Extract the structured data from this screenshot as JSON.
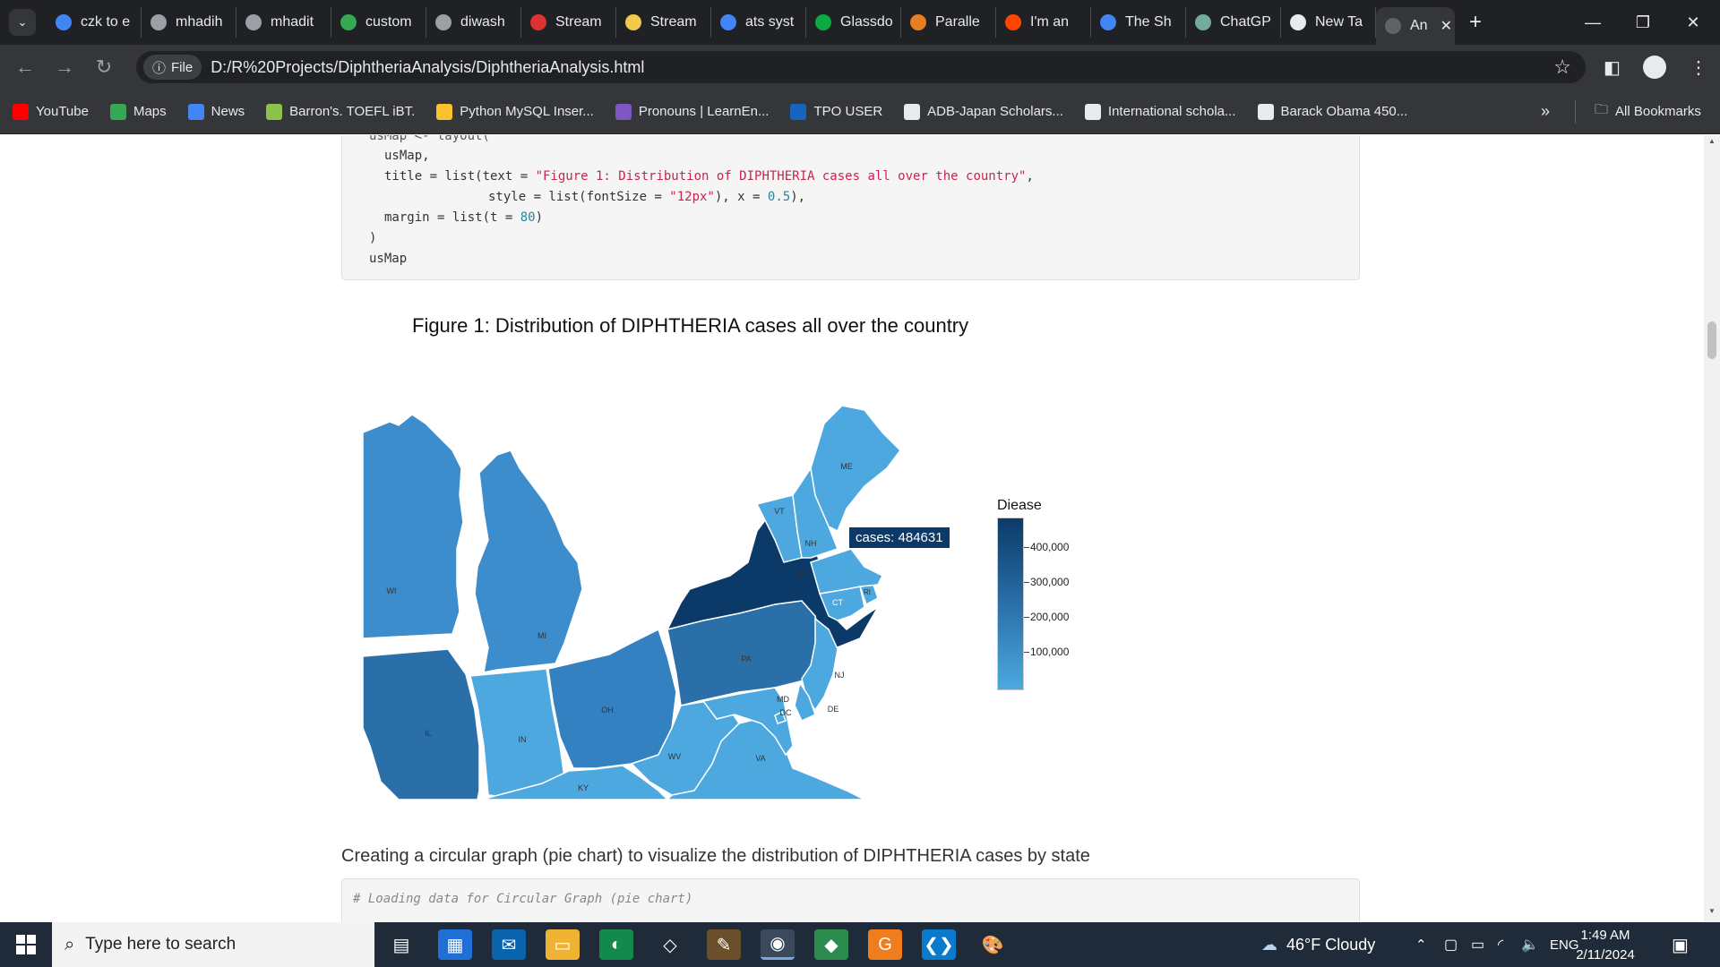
{
  "browser": {
    "tabs": [
      {
        "label": "czk to e",
        "color": "#4285f4"
      },
      {
        "label": "mhadih",
        "color": "#9aa0a6"
      },
      {
        "label": "mhadit",
        "color": "#9aa0a6"
      },
      {
        "label": "custom",
        "color": "#34a853"
      },
      {
        "label": "diwash",
        "color": "#9aa0a6"
      },
      {
        "label": "Stream",
        "color": "#e03131"
      },
      {
        "label": "Stream",
        "color": "#f2c94c"
      },
      {
        "label": "ats syst",
        "color": "#4285f4"
      },
      {
        "label": "Glassdo",
        "color": "#0caa41"
      },
      {
        "label": "Paralle",
        "color": "#e67e22"
      },
      {
        "label": "I'm an",
        "color": "#ff4500"
      },
      {
        "label": "The Sh",
        "color": "#4285f4"
      },
      {
        "label": "ChatGP",
        "color": "#74aa9c"
      },
      {
        "label": "New Ta",
        "color": "#e8eaed"
      }
    ],
    "active_tab": "An",
    "new_tab_icon": "+",
    "url": "D:/R%20Projects/DiphtheriaAnalysis/DiphtheriaAnalysis.html",
    "file_chip": "File",
    "bookmarks": [
      {
        "label": "YouTube",
        "color": "#ff0000"
      },
      {
        "label": "Maps",
        "color": "#34a853"
      },
      {
        "label": "News",
        "color": "#4285f4"
      },
      {
        "label": "Barron's. TOEFL iBT.",
        "color": "#8bc34a"
      },
      {
        "label": "Python MySQL Inser...",
        "color": "#fbc02d"
      },
      {
        "label": "Pronouns | LearnEn...",
        "color": "#7e57c2"
      },
      {
        "label": "TPO USER",
        "color": "#1565c0"
      },
      {
        "label": "ADB-Japan Scholars...",
        "color": "#e8eaed"
      },
      {
        "label": "International schola...",
        "color": "#e8eaed"
      },
      {
        "label": "Barack Obama 450...",
        "color": "#e8eaed"
      }
    ],
    "all_bookmarks": "All Bookmarks",
    "more_bookmarks": "»"
  },
  "page": {
    "code_top": {
      "partial": "usMap <- layout(",
      "l1": "usMap,",
      "l2_pre": "title = list(text = ",
      "l2_str": "\"Figure 1: Distribution of DIPHTHERIA cases all over the country\"",
      "l2_post": ",",
      "l3_pre": "style = list(fontSize = ",
      "l3_str": "\"12px\"",
      "l3_mid": "), x = ",
      "l3_num": "0.5",
      "l3_post": "),",
      "l4_pre": "margin = list(t = ",
      "l4_num": "80",
      "l4_post": ")",
      "l5": ")",
      "l6": "usMap"
    },
    "figure_title": "Figure 1: Distribution of DIPHTHERIA cases all over the country",
    "map": {
      "states": [
        {
          "abbr": "ME",
          "color": "#4da8e0"
        },
        {
          "abbr": "VT",
          "color": "#4da8e0"
        },
        {
          "abbr": "NH",
          "color": "#4da8e0"
        },
        {
          "abbr": "NY",
          "color": "#0c3a68"
        },
        {
          "abbr": "CT",
          "color": "#4da8e0"
        },
        {
          "abbr": "RI",
          "color": "#4da8e0"
        },
        {
          "abbr": "WI",
          "color": "#3d8ccc"
        },
        {
          "abbr": "MI",
          "color": "#3d8ccc"
        },
        {
          "abbr": "PA",
          "color": "#2a6fa8"
        },
        {
          "abbr": "NJ",
          "color": "#4da8e0"
        },
        {
          "abbr": "OH",
          "color": "#3381c0"
        },
        {
          "abbr": "MD",
          "color": "#4da8e0"
        },
        {
          "abbr": "DE",
          "color": "#4da8e0"
        },
        {
          "abbr": "DC",
          "color": "#4da8e0"
        },
        {
          "abbr": "IL",
          "color": "#2a6fa8"
        },
        {
          "abbr": "IN",
          "color": "#4da8e0"
        },
        {
          "abbr": "WV",
          "color": "#4da8e0"
        },
        {
          "abbr": "VA",
          "color": "#4da8e0"
        },
        {
          "abbr": "KY",
          "color": "#4da8e0"
        }
      ],
      "tooltip": "cases: 484631"
    },
    "colorbar": {
      "title": "Diease",
      "ticks": [
        "400,000",
        "300,000",
        "200,000",
        "100,000"
      ],
      "ticks_value": [
        400000,
        300000,
        200000,
        100000
      ],
      "range": [
        50000,
        484631
      ]
    },
    "prose": "Creating a circular graph (pie chart) to visualize the distribution of DIPHTHERIA cases by state",
    "code_bottom": {
      "comment": "# Loading data for Circular Graph (pie chart)"
    }
  },
  "taskbar": {
    "search_placeholder": "Type here to search",
    "weather": "46°F Cloudy",
    "lang": "ENG",
    "time": "1:49 AM",
    "date": "2/11/2024"
  }
}
